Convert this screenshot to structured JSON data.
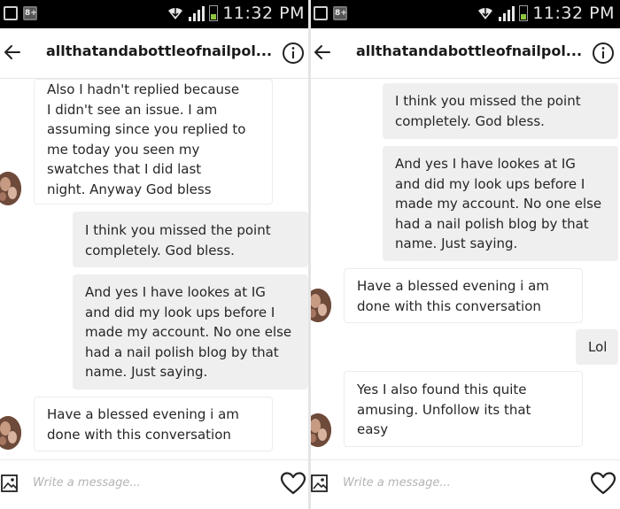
{
  "status_bar": {
    "time": "11:32 PM"
  },
  "header": {
    "title": "allthatandabottleofnailpol..."
  },
  "composer": {
    "placeholder": "Write a message..."
  },
  "left": {
    "messages": [
      {
        "dir": "in",
        "text": "Also I hadn't replied because\nI didn't see an issue. I am\nassuming since you replied to\nme today you seen my\nswatches that I did last\nnight. Anyway God bless"
      },
      {
        "dir": "out",
        "text": "I think you missed the point\ncompletely. God bless."
      },
      {
        "dir": "out",
        "text": "And yes I have lookes at IG\nand did my look ups before I\nmade my account. No one else\nhad a nail polish blog by that\nname. Just saying."
      },
      {
        "dir": "in",
        "text": "Have a blessed evening i am\ndone with this conversation"
      }
    ]
  },
  "right": {
    "messages": [
      {
        "dir": "out",
        "text": "I think you missed the point\ncompletely. God bless."
      },
      {
        "dir": "out",
        "text": "And yes I have lookes at IG\nand did my look ups before I\nmade my account. No one else\nhad a nail polish blog by that\nname. Just saying."
      },
      {
        "dir": "in",
        "text": "Have a blessed evening i am\ndone with this conversation"
      },
      {
        "dir": "out",
        "text": "Lol"
      },
      {
        "dir": "in",
        "text": "Yes I also found this quite\namusing. Unfollow its that\neasy"
      }
    ]
  },
  "icons": {
    "back": "arrow-left-icon",
    "info": "info-circle-icon",
    "gallery": "gallery-icon",
    "heart": "heart-icon",
    "avatar": "nail-polish-avatar"
  },
  "colors": {
    "status_bar_bg": "#000000",
    "outgoing_bubble": "#efefef",
    "incoming_bubble": "#ffffff",
    "text": "#262626",
    "placeholder": "#b4b4b4",
    "battery": "#8fc540"
  }
}
